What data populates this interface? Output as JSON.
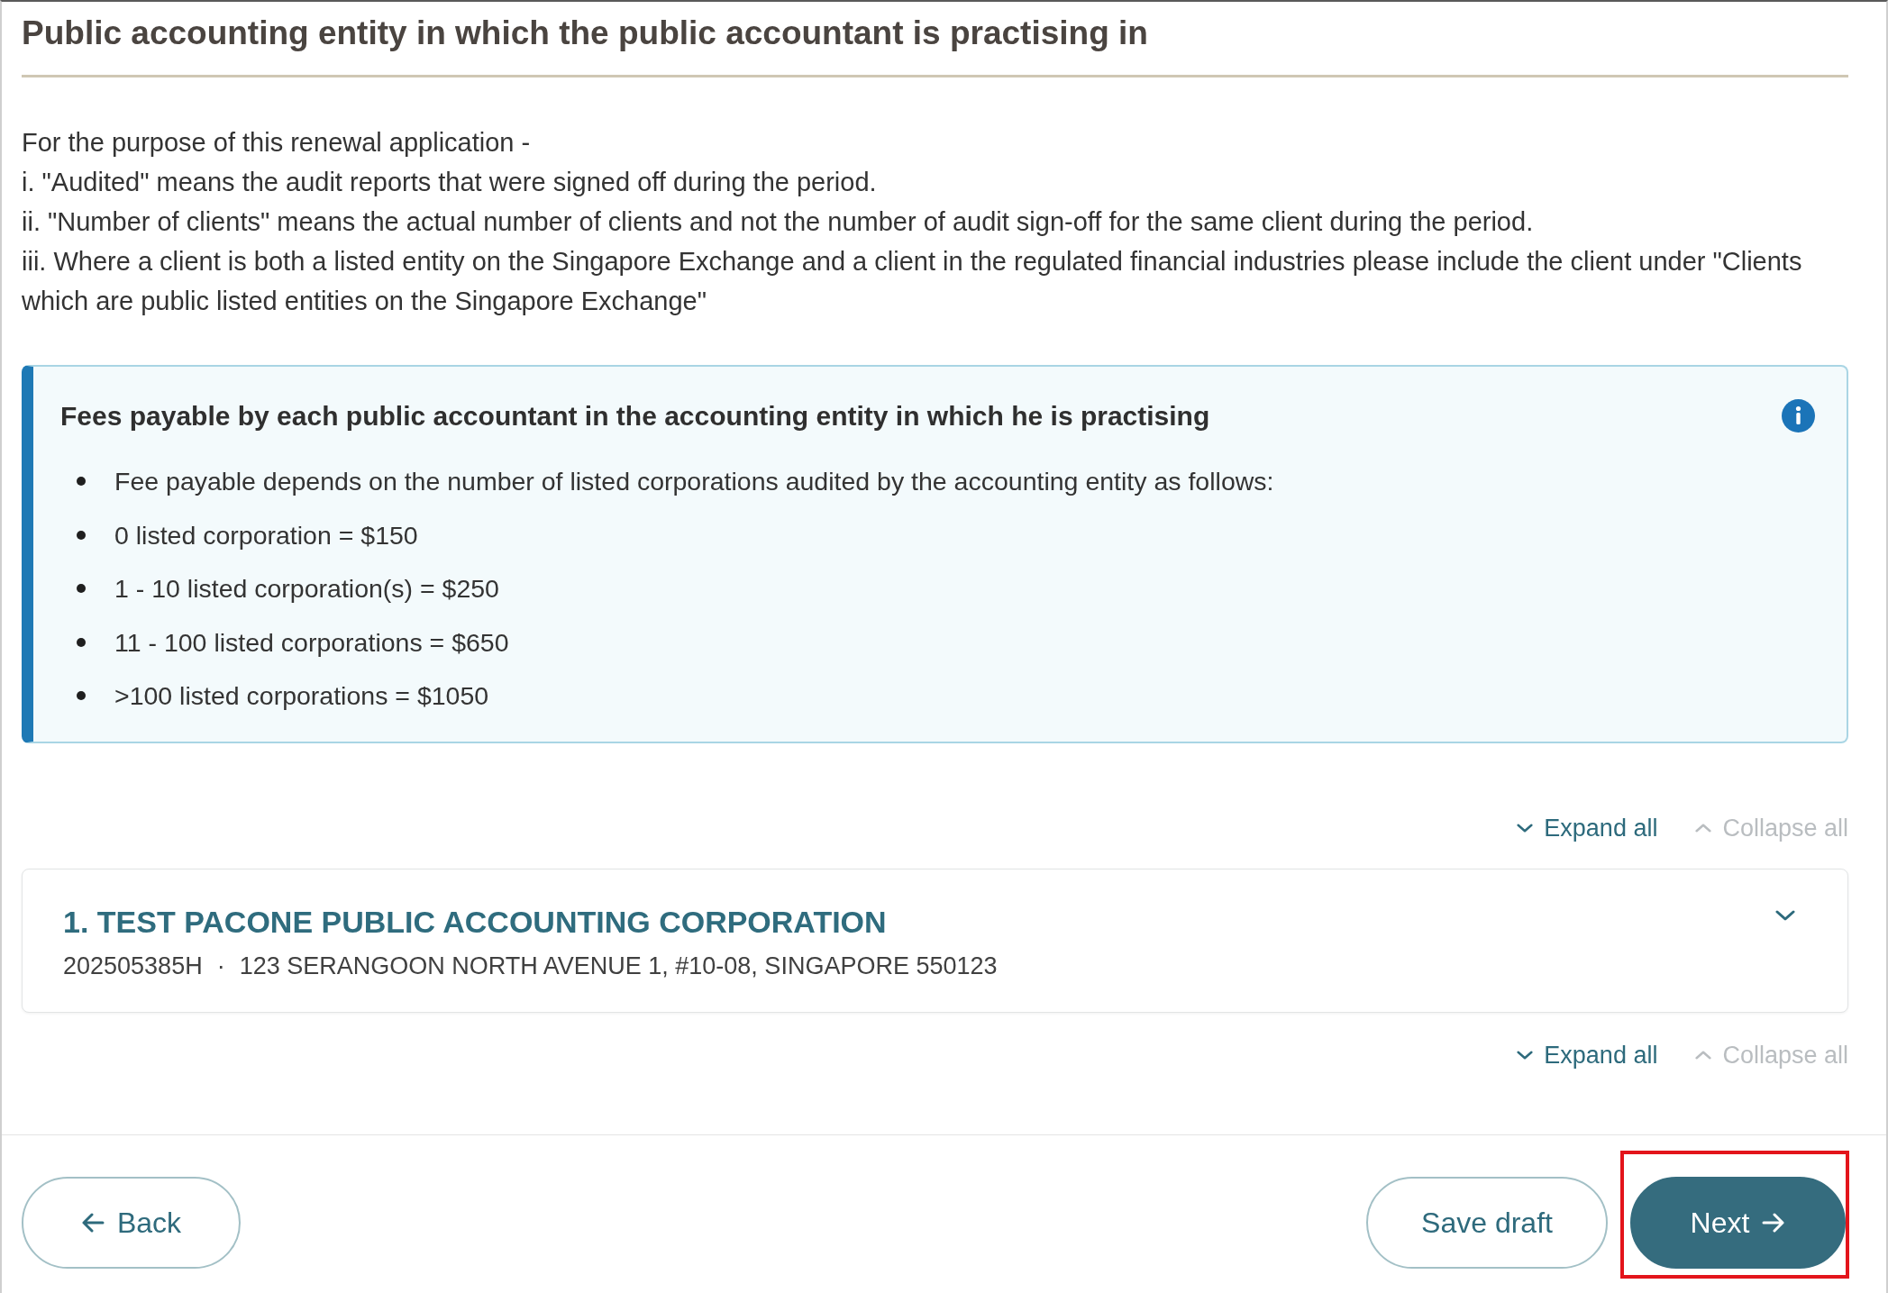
{
  "page": {
    "title": "Public accounting entity in which the public accountant is practising in"
  },
  "intro": {
    "lines": [
      "For the purpose of this renewal application -",
      "i. \"Audited\" means the audit reports that were signed off during the period.",
      "ii. \"Number of clients\" means the actual number of clients and not the number of audit sign-off for the same client during the period.",
      "iii. Where a client is both a listed entity on the Singapore Exchange and a client in the regulated financial industries please include the client under \"Clients which are public listed entities on the Singapore Exchange\""
    ]
  },
  "fee_notice": {
    "title": "Fees payable by each public accountant in the accounting entity in which he is practising",
    "items": [
      "Fee payable depends on the number of listed corporations audited by the accounting entity as follows:",
      "0 listed corporation = $150",
      "1 - 10 listed corporation(s) = $250",
      "11 - 100 listed corporations = $650",
      ">100 listed corporations = $1050"
    ]
  },
  "accordion": {
    "toolbar_top": {
      "expand_all": {
        "label": "Expand all",
        "disabled": false
      },
      "collapse_all": {
        "label": "Collapse all",
        "disabled": true
      }
    },
    "items": [
      {
        "title": "1. TEST PACONE PUBLIC ACCOUNTING CORPORATION",
        "uen": "202505385H",
        "separator": "·",
        "address": "123 SERANGOON NORTH AVENUE 1, #10-08, SINGAPORE 550123",
        "expanded": false
      }
    ],
    "toolbar_bottom": {
      "expand_all": {
        "label": "Expand all",
        "disabled": false
      },
      "collapse_all": {
        "label": "Collapse all",
        "disabled": true
      }
    }
  },
  "footer": {
    "buttons": [
      {
        "kind": "back",
        "label": "Back",
        "highlighted": false
      },
      {
        "kind": "outline",
        "label": "Save draft",
        "highlighted": false
      },
      {
        "kind": "primary",
        "label": "Next",
        "highlighted": true
      }
    ]
  }
}
